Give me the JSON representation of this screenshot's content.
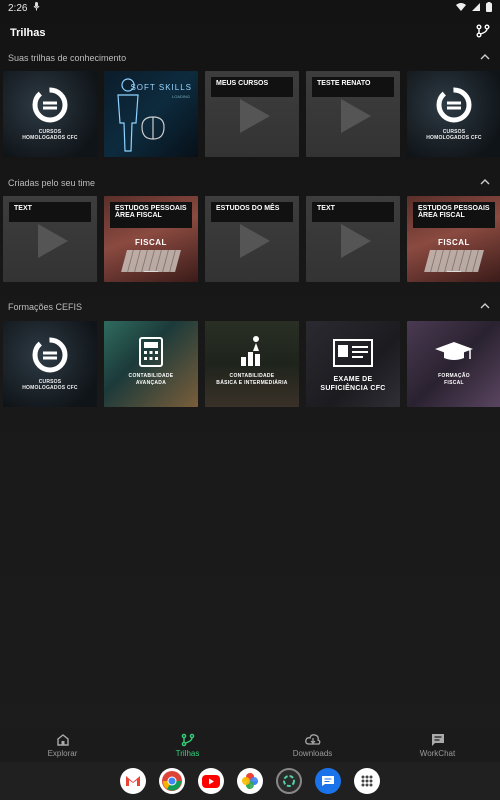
{
  "status": {
    "time": "2:26"
  },
  "app": {
    "title": "Trilhas"
  },
  "sections": [
    {
      "title": "Suas trilhas de conhecimento",
      "cards": [
        {
          "kind": "logo",
          "caption": "CURSOS\nHOMOLOGADOS CFC"
        },
        {
          "kind": "soft",
          "title": "SOFT SKILLS",
          "subtitle": "LOADING"
        },
        {
          "kind": "placeholder",
          "title": "MEUS CURSOS"
        },
        {
          "kind": "placeholder",
          "title": "TESTE RENATO"
        },
        {
          "kind": "logo",
          "caption": "CURSOS\nHOMOLOGADOS CFC"
        }
      ]
    },
    {
      "title": "Criadas pelo seu time",
      "cards": [
        {
          "kind": "placeholder",
          "title": "TEXT"
        },
        {
          "kind": "fiscal",
          "title": "ESTUDOS PESSOAIS ÁREA FISCAL",
          "word": "FISCAL"
        },
        {
          "kind": "placeholder",
          "title": "ESTUDOS DO MÊS"
        },
        {
          "kind": "placeholder",
          "title": "TEXT"
        },
        {
          "kind": "fiscal",
          "title": "ESTUDOS PESSOAIS ÁREA FISCAL",
          "word": "FISCAL"
        }
      ]
    },
    {
      "title": "Formações CEFIS",
      "cards": [
        {
          "kind": "logo",
          "caption": "CURSOS\nHOMOLOGADOS CFC"
        },
        {
          "kind": "cont-av",
          "caption": "CONTABILIDADE\nAVANÇADA"
        },
        {
          "kind": "cont-bas",
          "caption": "CONTABILIDADE\nBÁSICA E INTERMEDIÁRIA"
        },
        {
          "kind": "exame",
          "caption": "EXAME DE\nSUFICIÊNCIA CFC"
        },
        {
          "kind": "form",
          "caption": "FORMAÇÃO\nFISCAL"
        }
      ]
    }
  ],
  "nav": [
    {
      "label": "Explorar",
      "icon": "home-icon",
      "active": false
    },
    {
      "label": "Trilhas",
      "icon": "branch-icon",
      "active": true
    },
    {
      "label": "Downloads",
      "icon": "cloud-download-icon",
      "active": false
    },
    {
      "label": "WorkChat",
      "icon": "chat-icon",
      "active": false
    }
  ],
  "dock": [
    "gmail-icon",
    "chrome-icon",
    "youtube-icon",
    "photos-icon",
    "app-icon",
    "messages-icon",
    "apps-grid-icon"
  ],
  "colors": {
    "accent": "#33d17a",
    "background": "#161616"
  }
}
